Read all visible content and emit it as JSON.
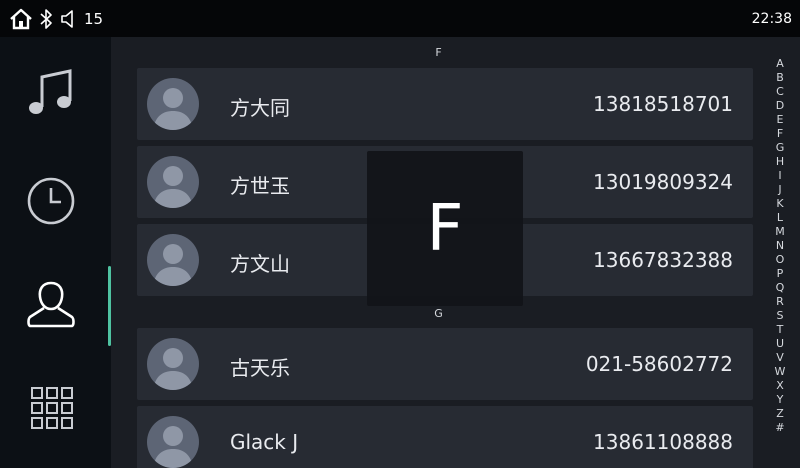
{
  "status_bar": {
    "home_icon": "home-icon",
    "bluetooth_icon": "bluetooth-icon",
    "volume_icon": "volume-icon",
    "volume_level": "15",
    "time": "22:38"
  },
  "nav": {
    "items": [
      {
        "name": "music",
        "icon": "music-note-icon"
      },
      {
        "name": "recent",
        "icon": "clock-icon"
      },
      {
        "name": "contacts",
        "icon": "person-icon",
        "active": true
      },
      {
        "name": "dialpad",
        "icon": "dialpad-grid-icon"
      }
    ],
    "active_color": "#4fc3a1"
  },
  "contacts": {
    "sections": [
      {
        "letter": "F",
        "entries": [
          {
            "name": "方大同",
            "phone": "13818518701"
          },
          {
            "name": "方世玉",
            "phone": "13019809324"
          },
          {
            "name": "方文山",
            "phone": "13667832388"
          }
        ]
      },
      {
        "letter": "G",
        "entries": [
          {
            "name": "古天乐",
            "phone": "021-58602772"
          },
          {
            "name": "Glack J",
            "phone": "13861108888"
          }
        ]
      }
    ]
  },
  "overlay": {
    "letter": "F"
  },
  "alphabet_index": [
    "A",
    "B",
    "C",
    "D",
    "E",
    "F",
    "G",
    "H",
    "I",
    "J",
    "K",
    "L",
    "M",
    "N",
    "O",
    "P",
    "Q",
    "R",
    "S",
    "T",
    "U",
    "V",
    "W",
    "X",
    "Y",
    "Z",
    "#"
  ]
}
